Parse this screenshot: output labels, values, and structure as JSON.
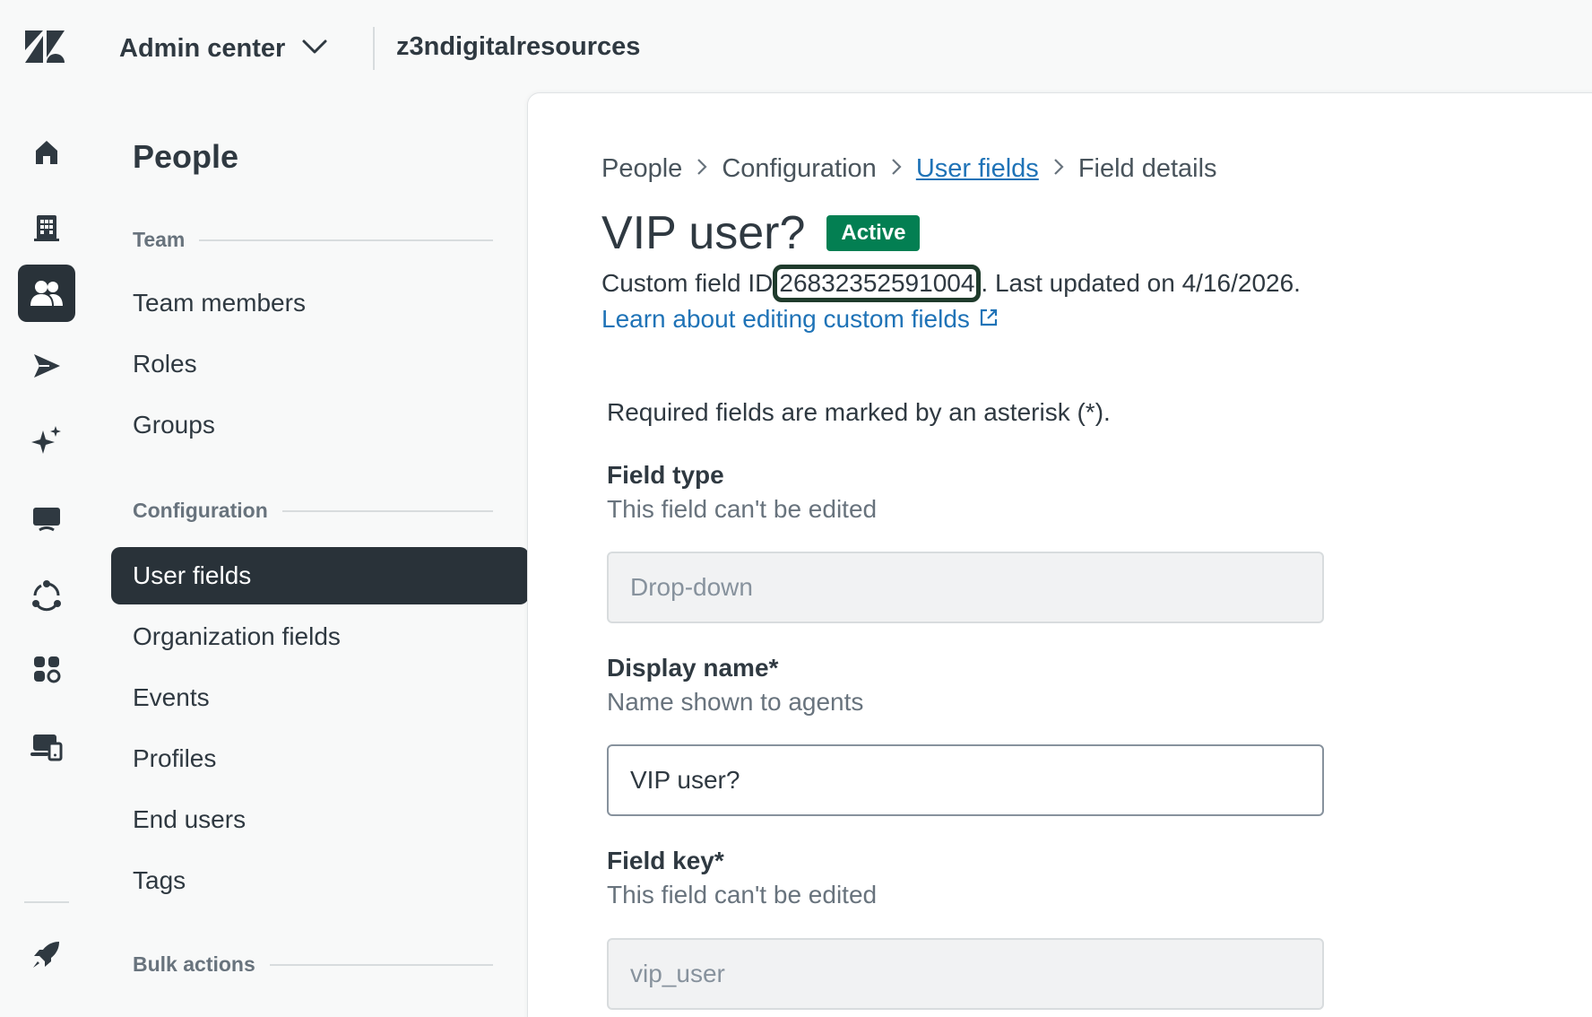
{
  "header": {
    "app_name": "Admin center",
    "subdomain": "z3ndigitalresources"
  },
  "rail": {
    "items": [
      {
        "icon": "home-icon"
      },
      {
        "icon": "building-icon"
      },
      {
        "icon": "people-icon",
        "active": true
      },
      {
        "icon": "send-icon"
      },
      {
        "icon": "sparkle-icon"
      },
      {
        "icon": "workspace-icon"
      },
      {
        "icon": "objects-icon"
      },
      {
        "icon": "apps-icon"
      },
      {
        "icon": "devices-icon"
      },
      {
        "icon": "rocket-icon"
      }
    ]
  },
  "subnav": {
    "title": "People",
    "team_heading": "Team",
    "team_items": [
      "Team members",
      "Roles",
      "Groups"
    ],
    "config_heading": "Configuration",
    "config_items": [
      "User fields",
      "Organization fields",
      "Events",
      "Profiles",
      "End users",
      "Tags"
    ],
    "active_item": "User fields",
    "bulk_heading": "Bulk actions"
  },
  "main": {
    "breadcrumb": [
      "People",
      "Configuration",
      "User fields",
      "Field details"
    ],
    "title": "VIP user?",
    "status_badge": "Active",
    "meta_prefix": "Custom field ID",
    "field_id": "26832352591004",
    "meta_suffix": ". Last updated on 4/16/2026.",
    "learn_link": "Learn about editing custom fields",
    "required_note": "Required fields are marked by an asterisk (*).",
    "fields": {
      "type_label": "Field type",
      "type_hint": "This field can't be edited",
      "type_value": "Drop-down",
      "display_label": "Display name*",
      "display_hint": "Name shown to agents",
      "display_value": "VIP user?",
      "key_label": "Field key*",
      "key_hint": "This field can't be edited",
      "key_value": "vip_user"
    }
  },
  "colors": {
    "accent": "#1f73b7",
    "active_nav": "#293239",
    "badge": "#037f52",
    "highlight_box": "#1f3b2c"
  }
}
